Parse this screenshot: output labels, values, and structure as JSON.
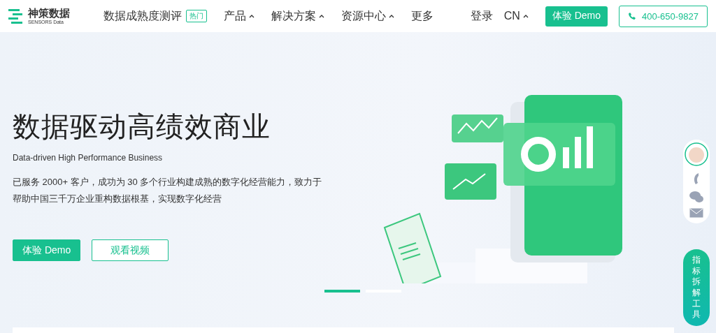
{
  "nav": {
    "logo": {
      "name": "神策数据",
      "sub": "SENSORS Data"
    },
    "items": [
      {
        "label": "数据成熟度测评",
        "badge": "热门",
        "has_caret": false
      },
      {
        "label": "产品",
        "has_caret": true
      },
      {
        "label": "解决方案",
        "has_caret": true
      },
      {
        "label": "资源中心",
        "has_caret": true
      },
      {
        "label": "更多",
        "has_caret": false
      }
    ],
    "login": "登录",
    "language": "CN",
    "demo_button": "体验 Demo",
    "phone": "400-650-9827"
  },
  "hero": {
    "title": "数据驱动高绩效商业",
    "subtitle": "Data-driven High Performance Business",
    "description": [
      "已服务 2000+ 客户，成功为 30 多个行业构建成熟的数字化经营能力，致力于",
      "帮助中国三千万企业重构数据根基，实现数字化经营"
    ],
    "buttons": [
      {
        "label": "体验 Demo",
        "kind": "primary"
      },
      {
        "label": "观看视频",
        "kind": "outline"
      }
    ]
  },
  "carousel": [
    {
      "selected": true
    },
    {
      "selected": false
    }
  ],
  "side_panel": {
    "tool_label": "指标拆解工具"
  }
}
